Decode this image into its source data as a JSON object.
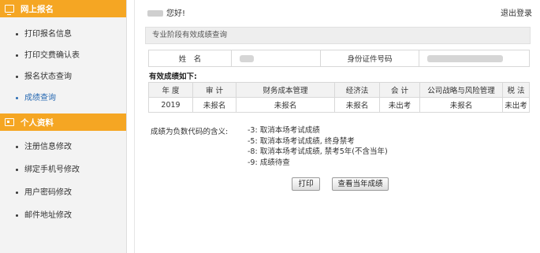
{
  "sidebar": {
    "section1": {
      "title": "网上报名",
      "icon": "monitor-icon"
    },
    "section1_items": [
      {
        "label": "打印报名信息"
      },
      {
        "label": "打印交费确认表"
      },
      {
        "label": "报名状态查询"
      },
      {
        "label": "成绩查询"
      }
    ],
    "section2": {
      "title": "个人资料",
      "icon": "id-card-icon"
    },
    "section2_items": [
      {
        "label": "注册信息修改"
      },
      {
        "label": "绑定手机号修改"
      },
      {
        "label": "用户密码修改"
      },
      {
        "label": "邮件地址修改"
      }
    ]
  },
  "header": {
    "greeting": "您好!",
    "logout": "退出登录"
  },
  "panel": {
    "title": "专业阶段有效成绩查询"
  },
  "info": {
    "name_label": "姓　名",
    "id_label": "身份证件号码"
  },
  "scores": {
    "caption": "有效成绩如下:",
    "headers": [
      "年 度",
      "审 计",
      "财务成本管理",
      "经济法",
      "会 计",
      "公司战略与风险管理",
      "税 法"
    ],
    "row": [
      "2019",
      "未报名",
      "未报名",
      "未报名",
      "未出考",
      "未报名",
      "未出考"
    ]
  },
  "legend": {
    "label": "成绩为负数代码的含义:",
    "codes": [
      "-3: 取消本场考试成绩",
      "-5: 取消本场考试成绩, 终身禁考",
      "-8: 取消本场考试成绩, 禁考5年(不含当年)",
      "-9: 成绩待查"
    ]
  },
  "buttons": {
    "print": "打印",
    "current_year": "查看当年成绩"
  },
  "colors": {
    "accent": "#f5a623",
    "link": "#2a6bb3",
    "sidebar_bg": "#f3f3f3"
  }
}
